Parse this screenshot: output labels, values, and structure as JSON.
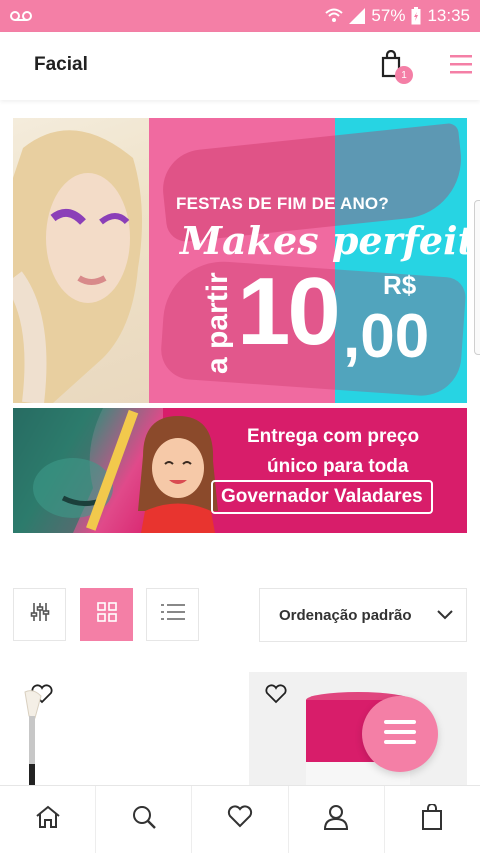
{
  "statusbar": {
    "battery": "57%",
    "time": "13:35"
  },
  "header": {
    "title": "Facial",
    "cart_count": "1"
  },
  "banner1": {
    "headline": "FESTAS DE FIM DE ANO?",
    "script": "Makes perfeitas",
    "prefix": "a partir",
    "currency": "R$",
    "amount": "10",
    "cents": ",00"
  },
  "banner2": {
    "line1": "Entrega com preço",
    "line2": "único para toda",
    "line3": "Governador Valadares"
  },
  "toolbar": {
    "sort_label": "Ordenação padrão"
  },
  "colors": {
    "accent": "#f47fa6",
    "banner_pink": "#d81d6a",
    "cyan": "#27d4e3"
  },
  "icons": [
    "voicemail-icon",
    "wifi-icon",
    "signal-icon",
    "battery-icon",
    "cart-icon",
    "hamburger-menu-icon",
    "filter-sliders-icon",
    "grid-view-icon",
    "list-view-icon",
    "chevron-down-icon",
    "heart-icon",
    "home-icon",
    "search-icon",
    "user-icon",
    "bag-icon"
  ]
}
